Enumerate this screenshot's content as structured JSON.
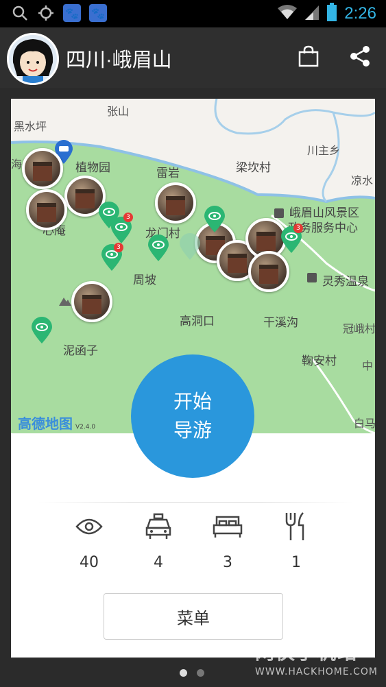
{
  "status_bar": {
    "time": "2:26"
  },
  "header": {
    "title": "四川·峨眉山"
  },
  "map": {
    "labels": [
      "张山",
      "黑水坪",
      "川主乡",
      "凉水",
      "植物园",
      "雷岩",
      "梁坎村",
      "峨眉山风景区",
      "政务服务中心",
      "心庵",
      "龙门村",
      "周坡",
      "灵秀温泉",
      "高洞口",
      "干溪沟",
      "冠峨村",
      "泥函子",
      "鞠安村",
      "中",
      "白马",
      "海"
    ],
    "badges": [
      "3",
      "3",
      "3"
    ],
    "provider_logo": "高德地图",
    "provider_version": "V2.4.0"
  },
  "start_button": {
    "line1": "开始",
    "line2": "导游"
  },
  "stats": [
    {
      "icon": "eye-icon",
      "count": "40"
    },
    {
      "icon": "taxi-icon",
      "count": "4"
    },
    {
      "icon": "bed-icon",
      "count": "3"
    },
    {
      "icon": "fork-knife-icon",
      "count": "1"
    }
  ],
  "menu_button": {
    "label": "菜单"
  },
  "watermark": {
    "brand": "网侠手机站",
    "url": "WWW.HACKHOME.COM"
  },
  "colors": {
    "accent": "#2a97dc",
    "map_green": "#a8dca0",
    "pin_green": "#2bb673"
  }
}
